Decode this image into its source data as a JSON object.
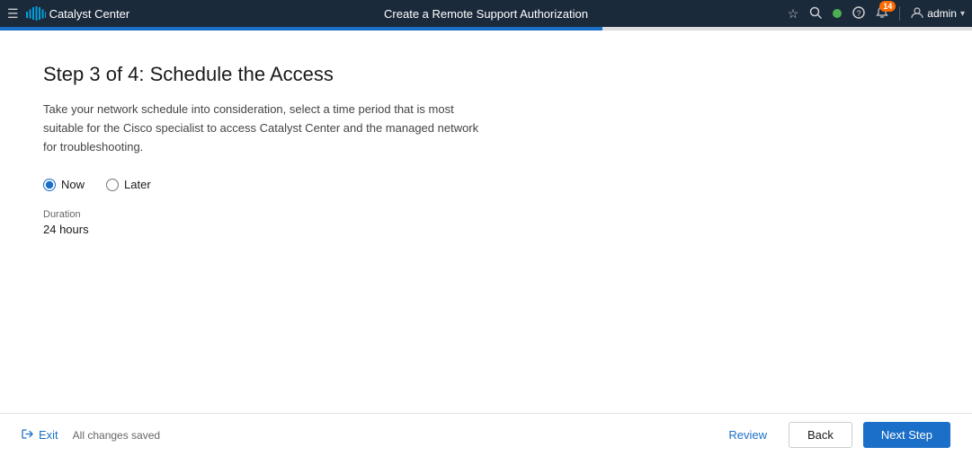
{
  "header": {
    "menu_icon": "☰",
    "app_title": "Catalyst Center",
    "page_title": "Create a Remote Support Authorization",
    "nav_icons": {
      "star": "☆",
      "search": "🔍",
      "status_dot": "active",
      "help": "?",
      "bell": "🔔",
      "notification_count": "14"
    },
    "user": {
      "name": "admin",
      "caret": "▾"
    }
  },
  "progress": {
    "fill_percent": "62%"
  },
  "main": {
    "step_title": "Step 3 of 4: Schedule the Access",
    "description": "Take your network schedule into consideration, select a time period that is most suitable for the Cisco specialist to access Catalyst Center and the managed network for troubleshooting.",
    "radio_options": [
      {
        "id": "now",
        "label": "Now",
        "checked": true
      },
      {
        "id": "later",
        "label": "Later",
        "checked": false
      }
    ],
    "duration_label": "Duration",
    "duration_value": "24 hours"
  },
  "footer": {
    "exit_label": "Exit",
    "saved_status": "All changes saved",
    "review_label": "Review",
    "back_label": "Back",
    "next_label": "Next Step"
  }
}
